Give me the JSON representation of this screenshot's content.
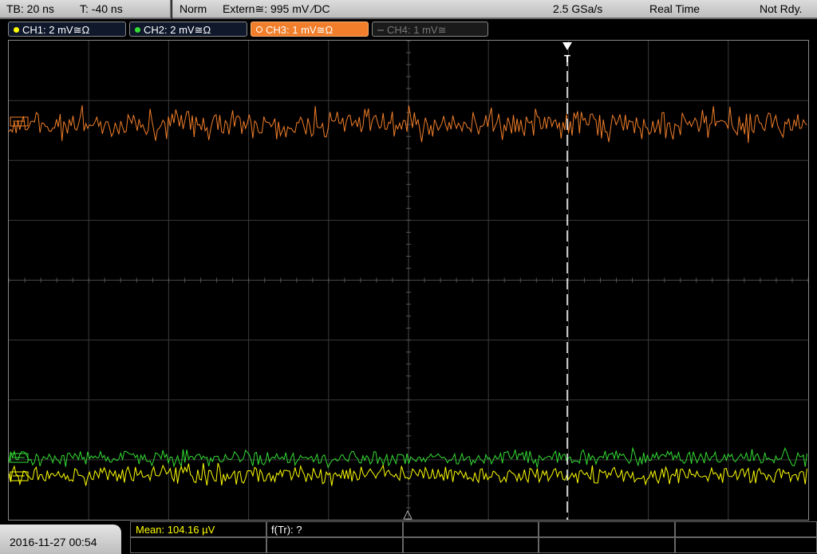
{
  "timebase": {
    "tb": "TB: 20 ns",
    "trigger_time": "T: -40 ns"
  },
  "acquisition": {
    "mode": "Norm",
    "trigger_source": "Extern≅: 995 mV ∕DC",
    "sample_rate": "2.5 GSa/s",
    "acq_mode": "Real Time",
    "status": "Not Rdy."
  },
  "channels": [
    {
      "label": "CH1: 2 mV≅Ω",
      "color": "#ffff00",
      "active": true
    },
    {
      "label": "CH2: 2 mV≅Ω",
      "color": "#33dd33",
      "active": true
    },
    {
      "label": "CH3: 1 mV≅Ω",
      "color": "#f07e2a",
      "active": true
    },
    {
      "label": "CH4: 1 mV≅",
      "color": "#777777",
      "active": false
    }
  ],
  "markers": {
    "trigger_marker": "T"
  },
  "colors": {
    "ch1": "#ffff00",
    "ch2": "#33dd33",
    "ch3": "#f07e2a",
    "grid": "#3a3a3a"
  },
  "footer": {
    "datetime": "2016-11-27 00:54",
    "measurement_1": "Mean: 104.16 µV",
    "measurement_2": "f(Tr): ?"
  }
}
